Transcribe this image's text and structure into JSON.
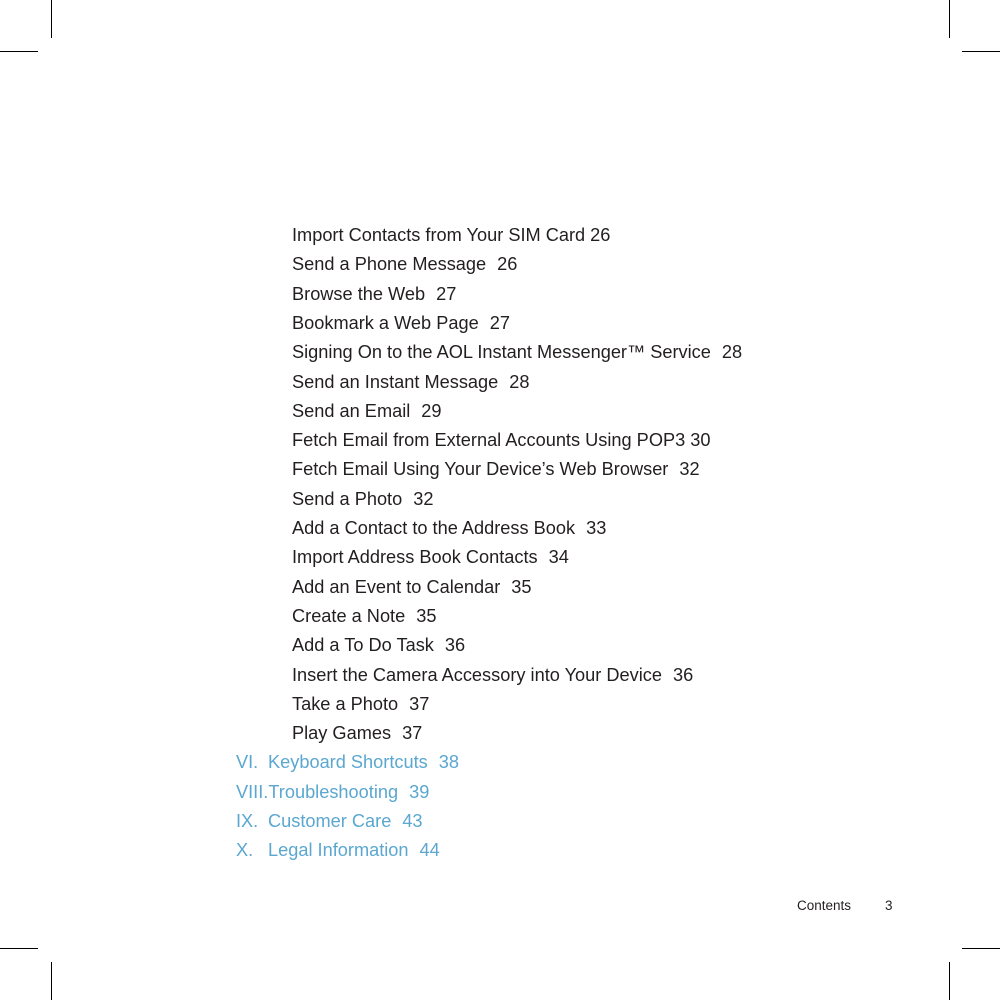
{
  "page": {
    "footer_label": "Contents",
    "footer_page_number": "3",
    "text_color": "#231F20",
    "accent_color": "#5BA7D0",
    "background_color": "#FFFFFF"
  },
  "toc": {
    "sub_entries": [
      {
        "title": "Import Contacts from Your SIM Card",
        "page": "26",
        "gap": "narrow"
      },
      {
        "title": "Send a Phone Message",
        "page": "26",
        "gap": "wide"
      },
      {
        "title": "Browse the Web",
        "page": "27",
        "gap": "wide"
      },
      {
        "title": "Bookmark a Web Page",
        "page": "27",
        "gap": "wide"
      },
      {
        "title": "Signing On to the AOL Instant Messenger™ Service",
        "page": "28",
        "gap": "wide"
      },
      {
        "title": "Send an Instant Message",
        "page": "28",
        "gap": "wide"
      },
      {
        "title": "Send an Email",
        "page": "29",
        "gap": "wide"
      },
      {
        "title": "Fetch Email from External Accounts Using POP3",
        "page": "30",
        "gap": "narrow"
      },
      {
        "title": "Fetch Email Using Your Device’s Web Browser",
        "page": "32",
        "gap": "wide"
      },
      {
        "title": "Send a Photo",
        "page": "32",
        "gap": "wide"
      },
      {
        "title": "Add a Contact to the Address Book",
        "page": "33",
        "gap": "wide"
      },
      {
        "title": "Import Address Book Contacts",
        "page": "34",
        "gap": "wide"
      },
      {
        "title": "Add an Event to Calendar",
        "page": "35",
        "gap": "wide"
      },
      {
        "title": "Create a Note",
        "page": "35",
        "gap": "wide"
      },
      {
        "title": "Add a To Do Task",
        "page": "36",
        "gap": "wide"
      },
      {
        "title": "Insert the Camera Accessory into Your Device",
        "page": "36",
        "gap": "wide"
      },
      {
        "title": "Take a Photo",
        "page": "37",
        "gap": "wide"
      },
      {
        "title": "Play Games",
        "page": "37",
        "gap": "wide"
      }
    ],
    "chapter_entries": [
      {
        "numeral": "VI.",
        "title": "Keyboard Shortcuts",
        "page": "38"
      },
      {
        "numeral": "VIII.",
        "title": "Troubleshooting",
        "page": "39"
      },
      {
        "numeral": "IX.",
        "title": "Customer Care",
        "page": "43"
      },
      {
        "numeral": "X.",
        "title": "Legal Information",
        "page": "44"
      }
    ]
  }
}
